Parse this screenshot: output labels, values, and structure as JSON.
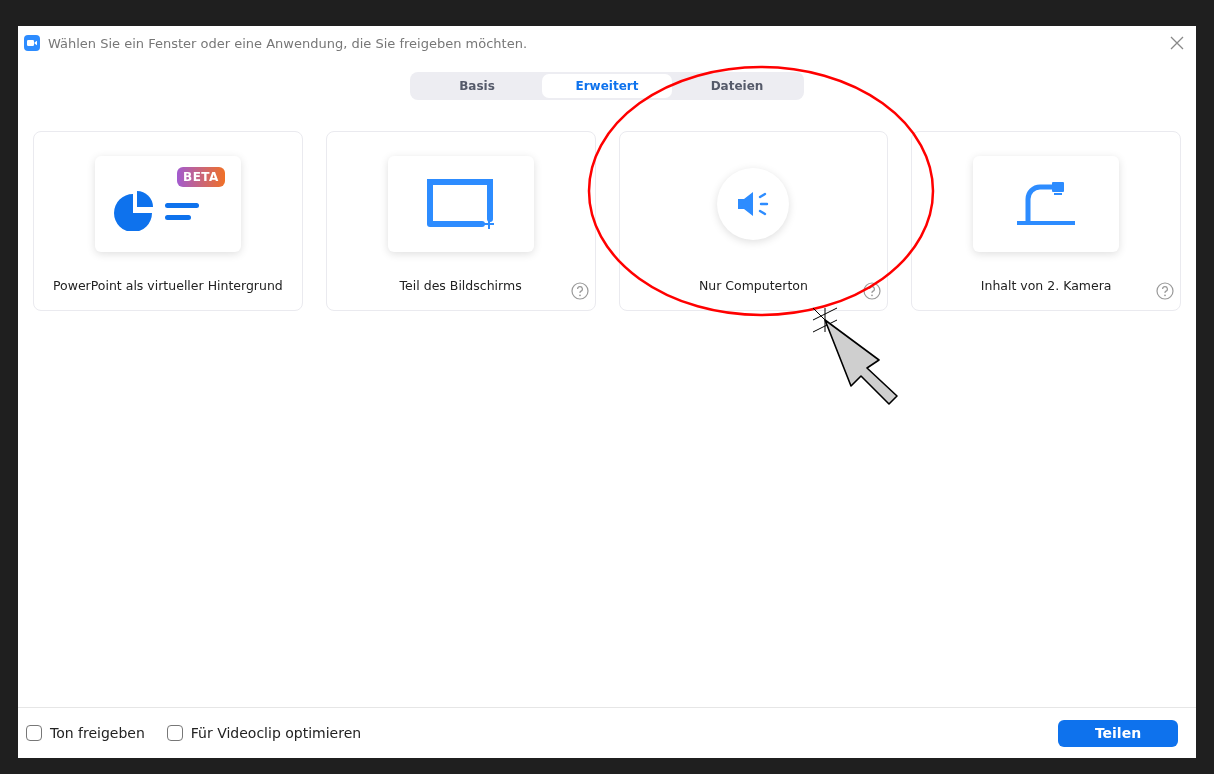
{
  "window": {
    "title": "Wählen Sie ein Fenster oder eine Anwendung, die Sie freigeben möchten."
  },
  "tabs": [
    {
      "label": "Basis",
      "selected": false
    },
    {
      "label": "Erweitert",
      "selected": true
    },
    {
      "label": "Dateien",
      "selected": false
    }
  ],
  "cards": [
    {
      "kind": "powerpoint",
      "label": "PowerPoint als virtueller Hintergrund",
      "badge": "BETA",
      "help": false
    },
    {
      "kind": "screen-part",
      "label": "Teil des Bildschirms",
      "help": true
    },
    {
      "kind": "audio",
      "label": "Nur Computerton",
      "help": true
    },
    {
      "kind": "camera",
      "label": "Inhalt von 2. Kamera",
      "help": true
    }
  ],
  "options": [
    {
      "label": "Ton freigeben",
      "checked": false
    },
    {
      "label": "Für Videoclip optimieren",
      "checked": false
    }
  ],
  "share_button": "Teilen"
}
